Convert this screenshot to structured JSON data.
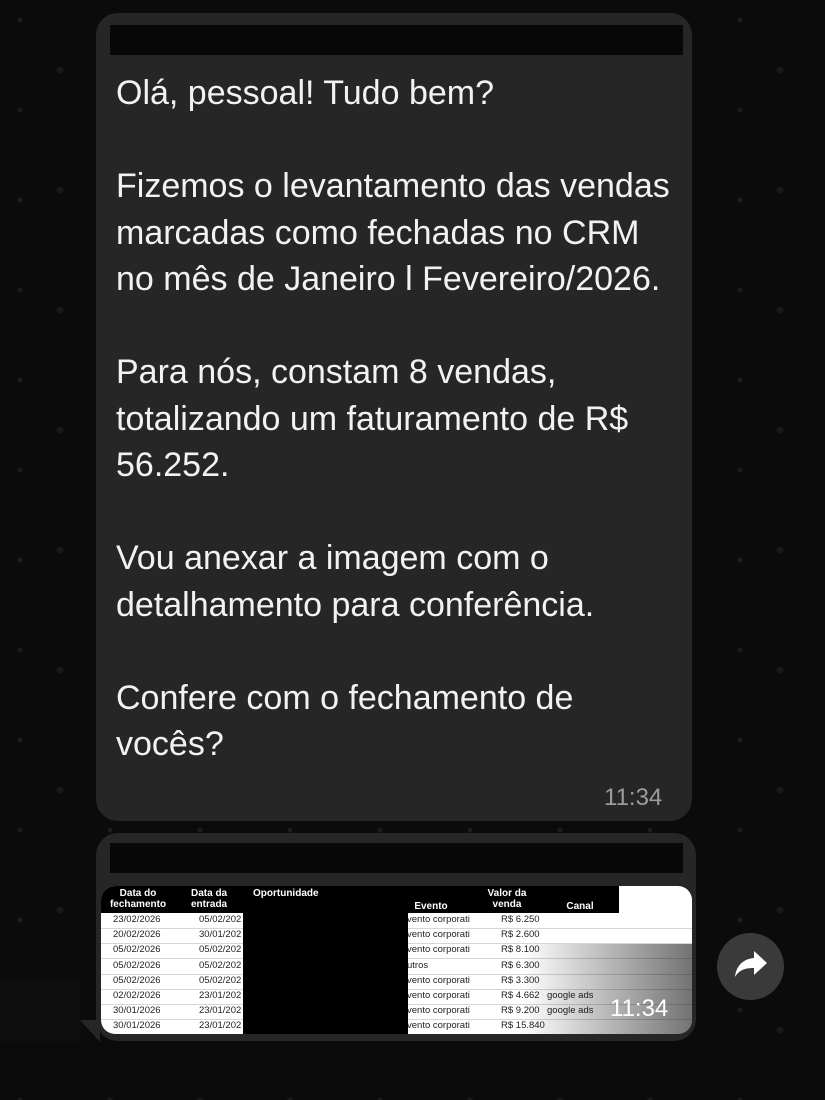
{
  "message": {
    "text": "Olá, pessoal! Tudo bem?\n\nFizemos o levantamento das vendas marcadas como fechadas no CRM no mês de Janeiro l Fevereiro/2026.\n\nPara nós, constam 8 vendas, totalizando um faturamento de R$ 56.252.\n\nVou anexar a imagem com o detalhamento para conferência.\n\nConfere com o fechamento de vocês?",
    "time": "11:34"
  },
  "attachment": {
    "time": "11:34",
    "headers": {
      "data_fechamento": "Data do fechamento",
      "data_entrada": "Data da entrada",
      "oportunidade": "Oportunidade",
      "evento": "Evento",
      "valor_venda": "Valor da venda",
      "canal": "Canal"
    },
    "rows": [
      {
        "fechamento": "23/02/2026",
        "entrada": "05/02/202",
        "evento": "vento corporati",
        "valor": "R$ 6.250",
        "canal": ""
      },
      {
        "fechamento": "20/02/2026",
        "entrada": "30/01/202",
        "evento": "vento corporati",
        "valor": "R$ 2.600",
        "canal": ""
      },
      {
        "fechamento": "05/02/2026",
        "entrada": "05/02/202",
        "evento": "vento corporati",
        "valor": "R$ 8.100",
        "canal": ""
      },
      {
        "fechamento": "05/02/2026",
        "entrada": "05/02/202",
        "evento": "utros",
        "valor": "R$ 6.300",
        "canal": ""
      },
      {
        "fechamento": "05/02/2026",
        "entrada": "05/02/202",
        "evento": "vento corporati",
        "valor": "R$ 3.300",
        "canal": ""
      },
      {
        "fechamento": "02/02/2026",
        "entrada": "23/01/202",
        "evento": "vento corporati",
        "valor": "R$ 4.662",
        "canal": "google ads"
      },
      {
        "fechamento": "30/01/2026",
        "entrada": "23/01/202",
        "evento": "vento corporati",
        "valor": "R$ 9.200",
        "canal": "google ads"
      },
      {
        "fechamento": "30/01/2026",
        "entrada": "23/01/202",
        "evento": "vento corporati",
        "valor": "R$ 15.840",
        "canal": ""
      }
    ]
  },
  "icons": {
    "forward": "forward-arrow-icon"
  },
  "colors": {
    "bubble": "#262626",
    "background": "#0b0b0b"
  }
}
